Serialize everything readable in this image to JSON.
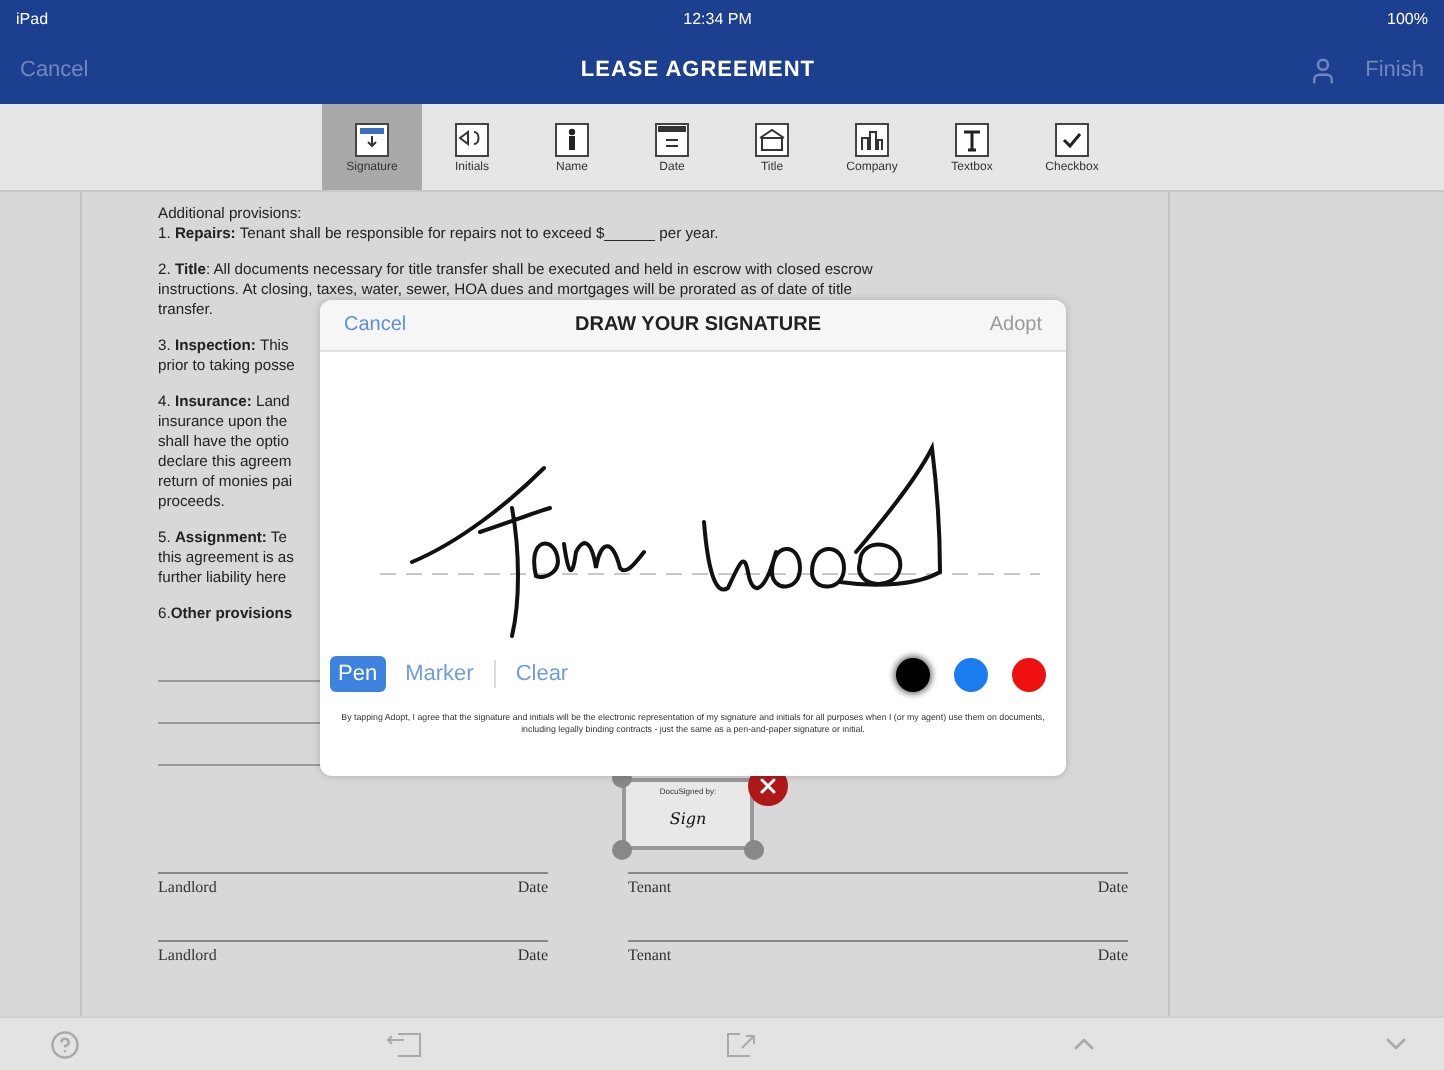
{
  "status_bar": {
    "device": "iPad",
    "time": "12:34 PM",
    "battery": "100%"
  },
  "nav": {
    "cancel": "Cancel",
    "title": "LEASE AGREEMENT",
    "finish": "Finish"
  },
  "tools": [
    {
      "label": "Signature",
      "kind": "signature",
      "selected": true
    },
    {
      "label": "Initials",
      "kind": "initials",
      "selected": false
    },
    {
      "label": "Name",
      "kind": "name",
      "selected": false
    },
    {
      "label": "Date",
      "kind": "date",
      "selected": false
    },
    {
      "label": "Title",
      "kind": "title",
      "selected": false
    },
    {
      "label": "Company",
      "kind": "company",
      "selected": false
    },
    {
      "label": "Textbox",
      "kind": "textbox",
      "selected": false
    },
    {
      "label": "Checkbox",
      "kind": "checkbox",
      "selected": false
    }
  ],
  "document": {
    "paragraphs": [
      {
        "lines": [
          "Additional provisions:",
          "1. **Repairs:** Tenant shall be responsible for repairs not to exceed $______ per year."
        ]
      },
      {
        "lines": [
          "2. **Title**: All documents necessary for title transfer shall be executed and held in escrow with closed escrow",
          "instructions. At closing, taxes, water, sewer, HOA dues and mortgages will be prorated as of date of title",
          "transfer."
        ]
      },
      {
        "lines": [
          "3. **Inspection:** This",
          "prior to taking posse"
        ]
      },
      {
        "lines": [
          "4. **Insurance:** Land",
          "insurance upon the",
          "shall have the optio",
          "declare this agreem",
          "return of monies pai",
          "proceeds."
        ]
      },
      {
        "lines": [
          "5. **Assignment:** Te",
          "this agreement is as",
          "further liability here"
        ]
      },
      {
        "lines": [
          "6.**Other provisions**"
        ]
      }
    ],
    "signature_tag": {
      "header": "DocuSigned by:",
      "mark": "Sign"
    },
    "signature_rows": [
      {
        "left": "Landlord",
        "left_date": "Date",
        "right": "Tenant",
        "right_date": "Date"
      },
      {
        "left": "Landlord",
        "left_date": "Date",
        "right": "Tenant",
        "right_date": "Date"
      }
    ]
  },
  "dialog": {
    "cancel": "Cancel",
    "title": "DRAW YOUR SIGNATURE",
    "adopt": "Adopt",
    "modes": [
      {
        "label": "Pen",
        "selected": true
      },
      {
        "label": "Marker",
        "selected": false
      },
      {
        "label": "Clear",
        "selected": false
      }
    ],
    "colors": [
      {
        "color": "#000000",
        "selected": true
      },
      {
        "color": "#1a7cf0",
        "selected": false
      },
      {
        "color": "#f01010",
        "selected": false
      }
    ],
    "disclaimer": "By tapping Adopt, I agree that the signature and initials will be the electronic representation of my signature and initials for all purposes when I (or my agent) use them on documents, including legally binding contracts - just the same as a pen-and-paper signature or initial."
  }
}
